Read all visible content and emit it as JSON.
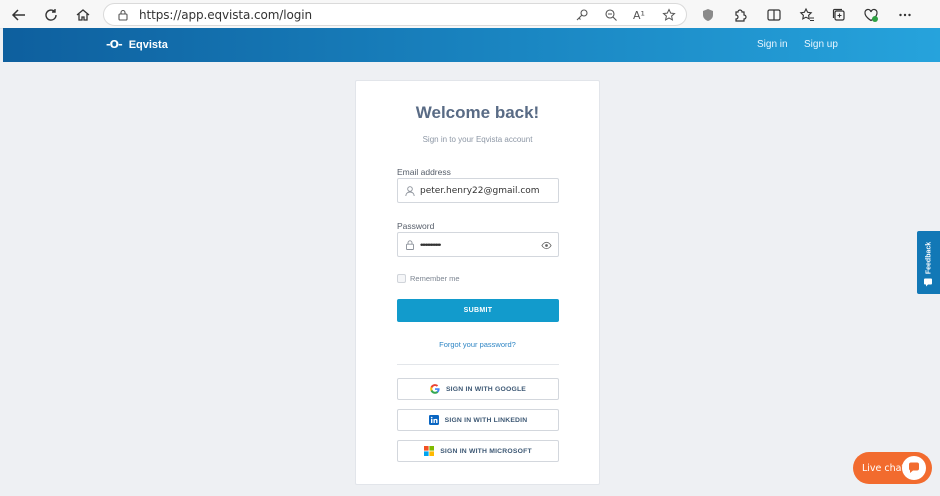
{
  "browser": {
    "url": "https://app.eqvista.com/login",
    "read_aloud_label": "A¹"
  },
  "header": {
    "brand_mark": "-O-",
    "brand_name": "Eqvista",
    "signin_label": "Sign in",
    "signup_label": "Sign up"
  },
  "login": {
    "title": "Welcome back!",
    "subtitle": "Sign in to your Eqvista account",
    "email_label": "Email address",
    "email_value": "peter.henry22@gmail.com",
    "password_label": "Password",
    "password_value": "••••••••••••",
    "remember_label": "Remember me",
    "submit_label": "SUBMIT",
    "forgot_label": "Forgot your password?",
    "google_label": "SIGN IN WITH GOOGLE",
    "linkedin_label": "SIGN IN WITH LINKEDIN",
    "microsoft_label": "SIGN IN WITH MICROSOFT"
  },
  "feedback": {
    "label": "Feedback"
  },
  "livechat": {
    "label": "Live chat"
  },
  "colors": {
    "header_start": "#0e5f9e",
    "header_end": "#26a3dc",
    "submit": "#129bcc",
    "livechat": "#f26b2e",
    "feedback": "#1278b6",
    "title": "#596b85"
  }
}
